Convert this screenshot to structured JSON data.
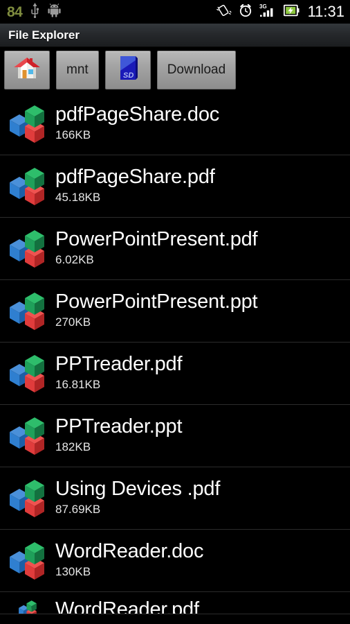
{
  "status_bar": {
    "battery_percent": "84",
    "battery_percent_color": "#7f8c3f",
    "icons": [
      "usb-icon",
      "android-robot-icon",
      "vibrate-icon",
      "alarm-clock-icon",
      "signal-3g-icon",
      "battery-charging-icon"
    ],
    "network_label": "3G",
    "clock": "11:31"
  },
  "title_bar": {
    "title": "File Explorer"
  },
  "path_bar": {
    "buttons": [
      {
        "label": "",
        "icon": "home-icon",
        "icon_only": true
      },
      {
        "label": "mnt",
        "icon": "",
        "icon_only": false
      },
      {
        "label": "",
        "icon": "sdcard-icon",
        "icon_only": true
      },
      {
        "label": "Download",
        "icon": "",
        "icon_only": false
      }
    ]
  },
  "file_list": {
    "rows": [
      {
        "name": "pdfPageShare.doc",
        "size": "166KB",
        "icon": "officesuite-icon",
        "partial": false
      },
      {
        "name": "pdfPageShare.pdf",
        "size": "45.18KB",
        "icon": "officesuite-icon",
        "partial": false
      },
      {
        "name": "PowerPointPresent.pdf",
        "size": "6.02KB",
        "icon": "officesuite-icon",
        "partial": false
      },
      {
        "name": "PowerPointPresent.ppt",
        "size": "270KB",
        "icon": "officesuite-icon",
        "partial": false
      },
      {
        "name": "PPTreader.pdf",
        "size": "16.81KB",
        "icon": "officesuite-icon",
        "partial": false
      },
      {
        "name": "PPTreader.ppt",
        "size": "182KB",
        "icon": "officesuite-icon",
        "partial": false
      },
      {
        "name": "Using Devices .pdf",
        "size": "87.69KB",
        "icon": "officesuite-icon",
        "partial": false
      },
      {
        "name": "WordReader.doc",
        "size": "130KB",
        "icon": "officesuite-icon",
        "partial": false
      },
      {
        "name": "WordReader.pdf",
        "size": "",
        "icon": "officesuite-icon",
        "partial": true
      }
    ]
  },
  "colors": {
    "background": "#000000",
    "row_divider": "#2c2c2c",
    "title_text": "#ffffff",
    "icon_green": "#1fa05a",
    "icon_blue": "#2f7fd0",
    "icon_red": "#e03c3c"
  }
}
